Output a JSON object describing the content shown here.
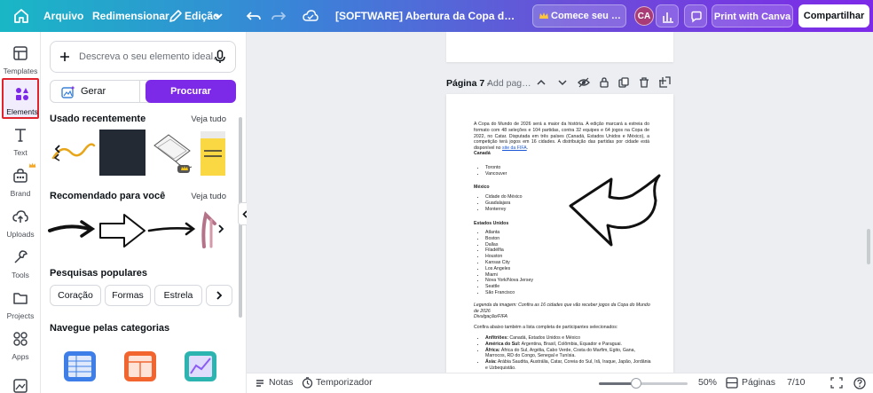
{
  "topbar": {
    "menu_file": "Arquivo",
    "menu_resize": "Redimensionar",
    "menu_edit": "Edição",
    "document_title": "[SOFTWARE] Abertura da Copa do Mundo hoje: onde assistir",
    "try_pro": "Comece seu teste grátis",
    "avatar_initials": "CA",
    "print_label": "Print with Canva",
    "share_label": "Compartilhar"
  },
  "rail": {
    "items": [
      {
        "label": "Templates",
        "icon": "templates-icon"
      },
      {
        "label": "Elements",
        "icon": "elements-icon"
      },
      {
        "label": "Text",
        "icon": "text-icon"
      },
      {
        "label": "Brand",
        "icon": "brand-icon"
      },
      {
        "label": "Uploads",
        "icon": "uploads-icon"
      },
      {
        "label": "Tools",
        "icon": "tools-icon"
      },
      {
        "label": "Projects",
        "icon": "projects-icon"
      },
      {
        "label": "Apps",
        "icon": "apps-icon"
      }
    ]
  },
  "panel": {
    "search_placeholder": "Descreva o seu elemento ideal.",
    "generate_label": "Gerar",
    "search_button": "Procurar",
    "recent_title": "Usado recentemente",
    "recent_see_all": "Veja tudo",
    "recommended_title": "Recomendado para você",
    "recommended_see_all": "Veja tudo",
    "popular_title": "Pesquisas populares",
    "popular_pills": [
      "Coração",
      "Formas",
      "Estrela"
    ],
    "categories_title": "Navegue pelas categorias"
  },
  "page": {
    "label": "Página 7 -",
    "title_placeholder": "Add page title",
    "intro": "A Copa do Mundo de 2026 será a maior da história. A edição marcará a estreia do formato com 48 seleções e 104 partidas, contra 32 equipes e 64 jogos na Copa de 2022, no Catar. Disputada em três países (Canadá, Estados Unidos e México), a competição terá jogos em 16 cidades. A distribuição das partidas por cidade está disponível no",
    "intro_link": "site da FIFA",
    "canada_title": "Canadá",
    "canada_cities": [
      "Toronto",
      "Vancouver"
    ],
    "mexico_title": "México",
    "mexico_cities": [
      "Cidade do México",
      "Guadalajara",
      "Monterrey"
    ],
    "usa_title": "Estados Unidos",
    "usa_cities": [
      "Atlanta",
      "Boston",
      "Dallas",
      "Filadélfia",
      "Houston",
      "Kansas City",
      "Los Angeles",
      "Miami",
      "Nova York/Nova Jersey",
      "Seattle",
      "São Francisco"
    ],
    "caption": "Legenda da imagem: Confira as 16 cidades que vão receber jogos da Copa do Mundo de 2026",
    "credit": "Divulgação/FIFA",
    "list_intro": "Confira abaixo também a lista completa de participantes selecionados:",
    "participants": [
      {
        "group": "Anfitriões:",
        "teams": "Canadá, Estados Unidos e México"
      },
      {
        "group": "América do Sul:",
        "teams": "Argentina, Brasil, Colômbia, Equador e Paraguai."
      },
      {
        "group": "África:",
        "teams": "África do Sul, Argélia, Cabo Verde, Costa do Marfim, Egito, Gana, Marrocos, RD do Congo, Senegal e Tunísia."
      },
      {
        "group": "Ásia:",
        "teams": "Arábia Saudita, Austrália, Catar, Coreia do Sul, Irã, Iraque, Japão, Jordânia e Uzbequistão."
      }
    ]
  },
  "bottombar": {
    "notes": "Notas",
    "timer": "Temporizador",
    "zoom": "50%",
    "zoom_fraction": 0.42,
    "pages": "Páginas",
    "page_count": "7/10"
  },
  "colors": {
    "accent": "#7d2ae8",
    "highlight_box": "#e0232c"
  }
}
